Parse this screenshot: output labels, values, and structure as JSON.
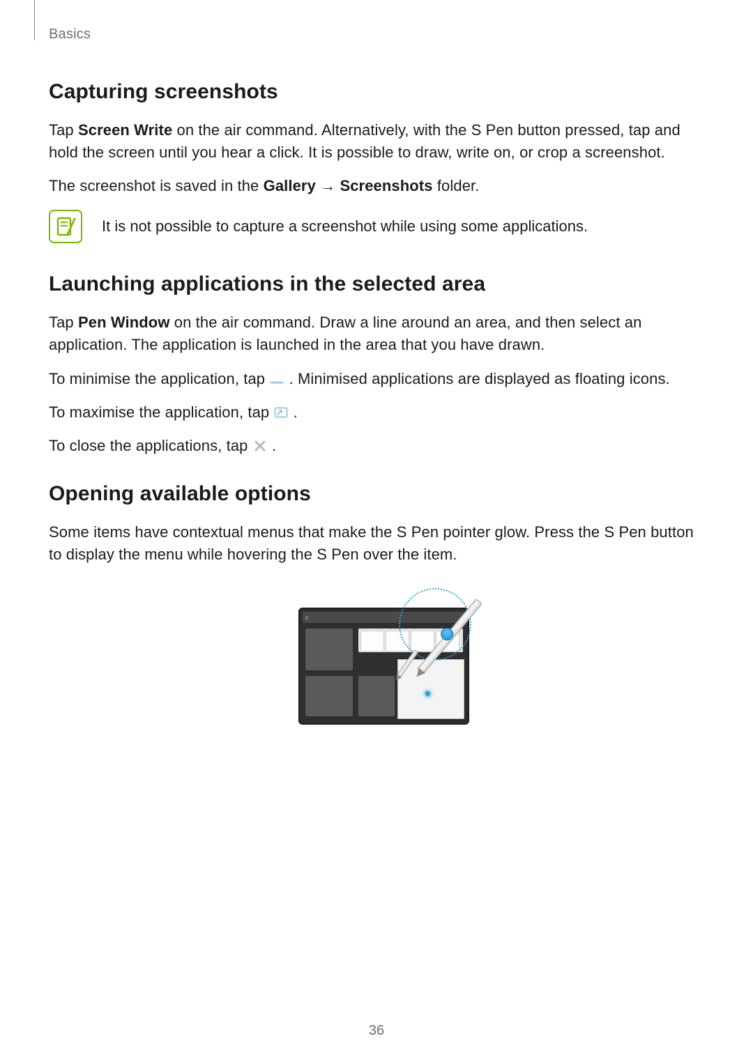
{
  "runningHead": "Basics",
  "pageNumber": "36",
  "sections": {
    "capturing": {
      "title": "Capturing screenshots",
      "p1_a": "Tap ",
      "p1_bold": "Screen Write",
      "p1_b": " on the air command. Alternatively, with the S Pen button pressed, tap and hold the screen until you hear a click. It is possible to draw, write on, or crop a screenshot.",
      "p2_a": "The screenshot is saved in the ",
      "p2_bold1": "Gallery",
      "p2_arrow": " → ",
      "p2_bold2": "Screenshots",
      "p2_b": " folder.",
      "note": "It is not possible to capture a screenshot while using some applications."
    },
    "launching": {
      "title": "Launching applications in the selected area",
      "p1_a": "Tap ",
      "p1_bold": "Pen Window",
      "p1_b": " on the air command. Draw a line around an area, and then select an application. The application is launched in the area that you have drawn.",
      "p2_a": "To minimise the application, tap ",
      "p2_b": ". Minimised applications are displayed as floating icons.",
      "p3_a": "To maximise the application, tap ",
      "p3_b": ".",
      "p4_a": "To close the applications, tap ",
      "p4_b": "."
    },
    "options": {
      "title": "Opening available options",
      "p1": "Some items have contextual menus that make the S Pen pointer glow. Press the S Pen button to display the menu while hovering the S Pen over the item."
    }
  }
}
